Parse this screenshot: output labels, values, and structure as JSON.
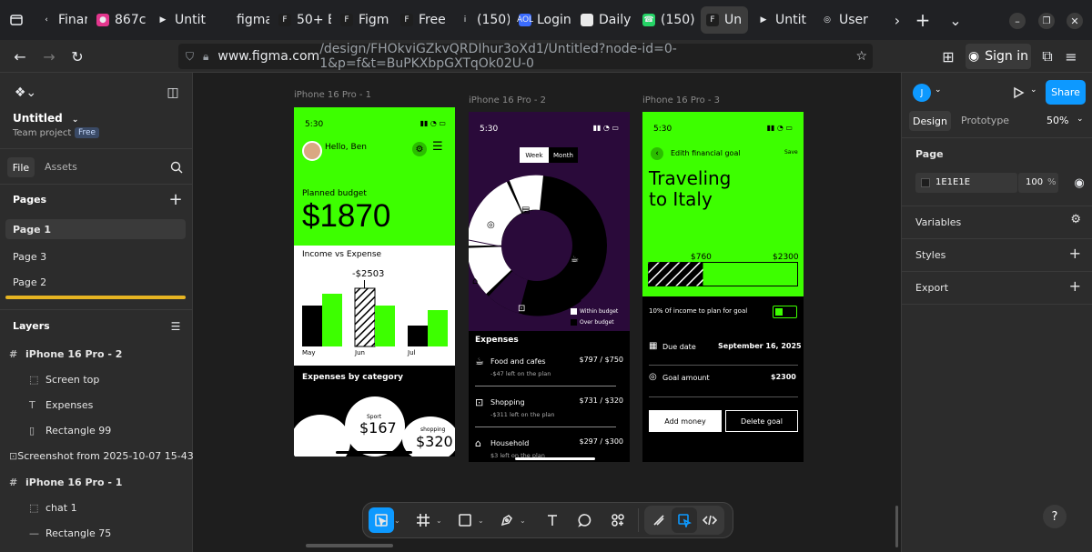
{
  "browser": {
    "tabs": [
      {
        "label": "Finar",
        "fav": "‹",
        "color": "#202124"
      },
      {
        "label": "867c",
        "fav": "●",
        "color": "#e2368d"
      },
      {
        "label": "Untit",
        "fav": "▶",
        "color": "#202124"
      },
      {
        "label": "figma.cc",
        "fav": "",
        "color": "#202124"
      },
      {
        "label": "50+ E",
        "fav": "F",
        "color": "#1e1e1e"
      },
      {
        "label": "Figm",
        "fav": "F",
        "color": "#1e1e1e"
      },
      {
        "label": "Free",
        "fav": "F",
        "color": "#1e1e1e"
      },
      {
        "label": "(150)",
        "fav": "i",
        "color": "#202124"
      },
      {
        "label": "Login",
        "fav": "AOL",
        "color": "#3b6cff"
      },
      {
        "label": "Daily",
        "fav": "U",
        "color": "#eaeaea"
      },
      {
        "label": "(150)",
        "fav": "☎",
        "color": "#25d366"
      },
      {
        "label": "Un",
        "fav": "F",
        "color": "#1e1e1e"
      },
      {
        "label": "Untit",
        "fav": "▶",
        "color": "#202124"
      },
      {
        "label": "User",
        "fav": "◎",
        "color": "#202124"
      }
    ],
    "url_host": "www.figma.com",
    "url_path": "/design/FHOkviGZkvQRDIhur3oXd1/Untitled?node-id=0-1&p=f&t=BuPKXbpGXTqOk02U-0",
    "signin_label": "Sign in"
  },
  "left_panel": {
    "file_name": "Untitled",
    "team": "Team project",
    "plan_badge": "Free",
    "tab_file": "File",
    "tab_assets": "Assets",
    "pages_title": "Pages",
    "pages": [
      "Page 1",
      "Page 3",
      "Page 2"
    ],
    "layers_title": "Layers",
    "layers": [
      {
        "label": "iPhone 16 Pro - 2",
        "icon": "#",
        "indent": 0,
        "bold": true
      },
      {
        "label": "Screen top",
        "icon": "⬚",
        "indent": 1,
        "bold": false
      },
      {
        "label": "Expenses",
        "icon": "T",
        "indent": 1,
        "bold": false
      },
      {
        "label": "Rectangle 99",
        "icon": "▯",
        "indent": 1,
        "bold": false
      },
      {
        "label": "Screenshot from 2025-10-07 15-43-55",
        "icon": "⊡",
        "indent": 0,
        "bold": false
      },
      {
        "label": "iPhone 16 Pro - 1",
        "icon": "#",
        "indent": 0,
        "bold": true
      },
      {
        "label": "chat 1",
        "icon": "⬚",
        "indent": 1,
        "bold": false
      },
      {
        "label": "Rectangle 75",
        "icon": "—",
        "indent": 1,
        "bold": false
      }
    ]
  },
  "right_panel": {
    "avatar": "J",
    "share_label": "Share",
    "tab_design": "Design",
    "tab_prototype": "Prototype",
    "zoom": "50%",
    "page_title": "Page",
    "page_color": "1E1E1E",
    "page_opacity": "100",
    "page_opacity_unit": "%",
    "variables": "Variables",
    "styles": "Styles",
    "export": "Export",
    "help": "?"
  },
  "frames": {
    "f1": {
      "label": "iPhone 16 Pro - 1",
      "time": "5:30",
      "greeting": "Hello, Ben",
      "budget_label": "Planned budget",
      "budget_value": "$1870",
      "chart_title": "Income vs Expense",
      "callout": "-$2503",
      "months": [
        "May",
        "Jun",
        "Jul"
      ],
      "cat_title": "Expenses by category",
      "cat_sport_label": "Sport",
      "cat_sport_value": "$167",
      "cat_shop_label": "shopping",
      "cat_shop_value": "$320"
    },
    "f2": {
      "label": "iPhone 16 Pro - 2",
      "time": "5:30",
      "toggle_week": "Week",
      "toggle_month": "Month",
      "legend_within": "Within budget",
      "legend_over": "Over budget",
      "expenses_title": "Expenses",
      "items": [
        {
          "name": "Food and cafes",
          "sub": "-$47 left on the plan",
          "amount": "$797 / $750"
        },
        {
          "name": "Shopping",
          "sub": "-$311 left on the plan",
          "amount": "$731 / $320"
        },
        {
          "name": "Household",
          "sub": "$3 left on the plan",
          "amount": "$297 / $300"
        }
      ]
    },
    "f3": {
      "label": "iPhone 16 Pro - 3",
      "time": "5:30",
      "header": "Edith financial goal",
      "save": "Save",
      "title_line1": "Traveling",
      "title_line2": "to Italy",
      "progress_current": "$760",
      "progress_target": "$2300",
      "income_note": "10% 0f income to plan for goal",
      "due_label": "Due date",
      "due_value": "September 16, 2025",
      "goal_label": "Goal amount",
      "goal_value": "$2300",
      "btn_add": "Add money",
      "btn_delete": "Delete  goal"
    }
  },
  "colors": {
    "accent_green": "#3dff00",
    "figma_blue": "#0d99ff",
    "purple_bg": "#2a0a3a"
  }
}
